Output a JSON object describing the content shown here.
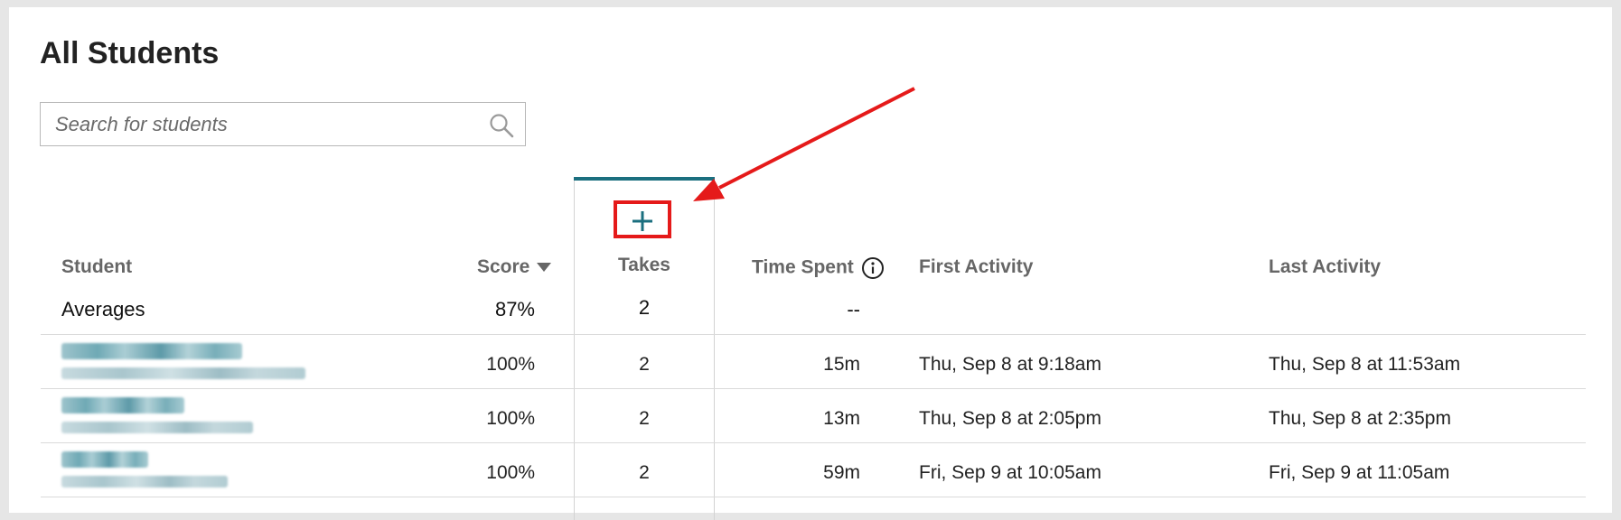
{
  "page": {
    "title": "All Students"
  },
  "search": {
    "placeholder": "Search for students"
  },
  "columns": {
    "student": "Student",
    "score": "Score",
    "takes": "Takes",
    "time_spent": "Time Spent",
    "first_activity": "First Activity",
    "last_activity": "Last Activity"
  },
  "averages": {
    "label": "Averages",
    "score": "87%",
    "takes": "2",
    "time_spent": "--"
  },
  "rows": [
    {
      "score": "100%",
      "takes": "2",
      "time_spent": "15m",
      "first_activity": "Thu, Sep 8 at 9:18am",
      "last_activity": "Thu, Sep 8 at 11:53am"
    },
    {
      "score": "100%",
      "takes": "2",
      "time_spent": "13m",
      "first_activity": "Thu, Sep 8 at 2:05pm",
      "last_activity": "Thu, Sep 8 at 2:35pm"
    },
    {
      "score": "100%",
      "takes": "2",
      "time_spent": "59m",
      "first_activity": "Fri, Sep 9 at 10:05am",
      "last_activity": "Fri, Sep 9 at 11:05am"
    }
  ],
  "colors": {
    "accent": "#1b6f7f",
    "annotation": "#e51a1a"
  },
  "icons": {
    "search": "search-icon",
    "add": "plus-icon",
    "info": "info-icon",
    "sort": "sort-down-icon"
  }
}
